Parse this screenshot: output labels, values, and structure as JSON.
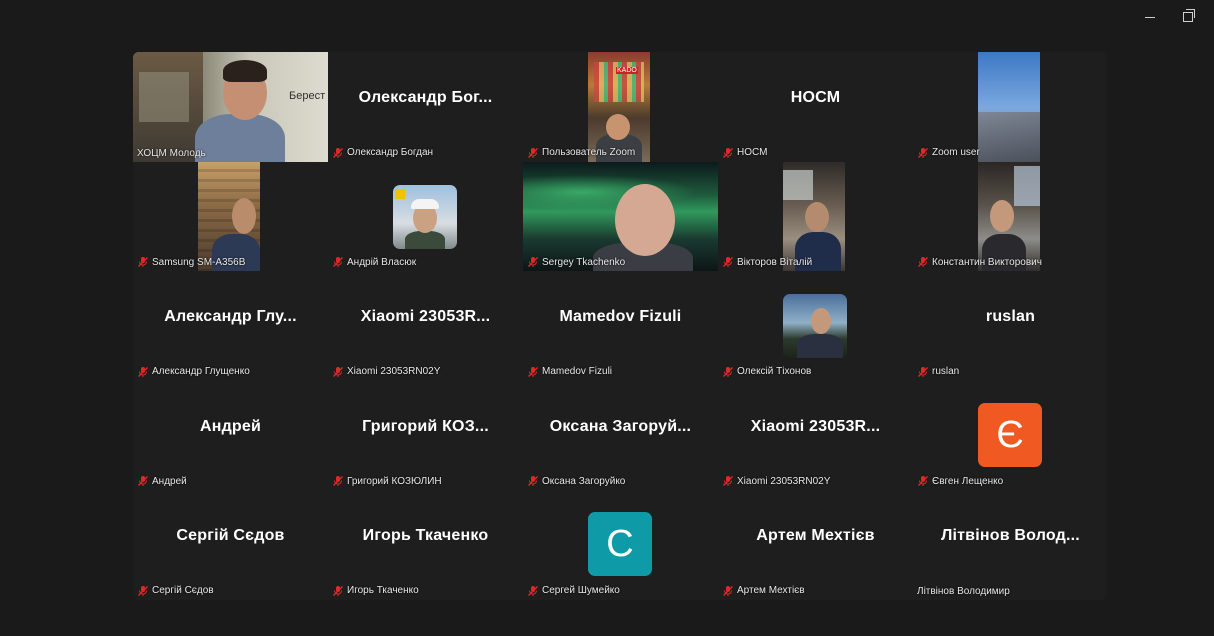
{
  "colors": {
    "background": "#1a1a1a",
    "tile": "#1e1e1e",
    "active_border": "#2fd37a",
    "muted_red": "#e02828"
  },
  "window": {
    "minimize_label": "—",
    "restore_label": "❐"
  },
  "tiles": [
    {
      "big": "",
      "label": "ХОЦМ Молодь",
      "muted": false,
      "overlay": "Берест"
    },
    {
      "big": "Олександр  Бог...",
      "label": "Олександр Богдан",
      "muted": true
    },
    {
      "big": "",
      "label": "Пользователь Zoom",
      "muted": true,
      "overlay": "KADO"
    },
    {
      "big": "НОСМ",
      "label": "НОСМ",
      "muted": true
    },
    {
      "big": "",
      "label": "Zoom user",
      "muted": true
    },
    {
      "big": "",
      "label": "Samsung SM-A356B",
      "muted": true
    },
    {
      "big": "",
      "label": "Андрій Власюк",
      "muted": true
    },
    {
      "big": "",
      "label": "Sergey Tkachenko",
      "muted": true
    },
    {
      "big": "",
      "label": "Вікторов Віталій",
      "muted": true
    },
    {
      "big": "",
      "label": "Константин Викторович",
      "muted": true
    },
    {
      "big": "Александр  Глу...",
      "label": "Александр Глущенко",
      "muted": true
    },
    {
      "big": "Xiaomi  23053R...",
      "label": "Xiaomi 23053RN02Y",
      "muted": true
    },
    {
      "big": "Mamedov Fizuli",
      "label": "Mamedov Fizuli",
      "muted": true
    },
    {
      "big": "",
      "label": "Олексій Тіхонов",
      "muted": true
    },
    {
      "big": "ruslan",
      "label": "ruslan",
      "muted": true
    },
    {
      "big": "Андрей",
      "label": "Андрей",
      "muted": true
    },
    {
      "big": "Григорий  КОЗ...",
      "label": "Григорий КОЗЮЛИН",
      "muted": true
    },
    {
      "big": "Оксана  Загоруй...",
      "label": "Оксана Загоруйко",
      "muted": true
    },
    {
      "big": "Xiaomi  23053R...",
      "label": "Xiaomi 23053RN02Y",
      "muted": true
    },
    {
      "big": "",
      "label": "Євген Лещенко",
      "muted": true,
      "avatar_letter": "Є",
      "avatar_color": "#f05a22"
    },
    {
      "big": "Сергій Сєдов",
      "label": "Сергій Сєдов",
      "muted": true
    },
    {
      "big": "Игорь Ткаченко",
      "label": "Игорь Ткаченко",
      "muted": true
    },
    {
      "big": "",
      "label": "Сергей Шумейко",
      "muted": true,
      "avatar_letter": "С",
      "avatar_color": "#0e9aa7"
    },
    {
      "big": "Артем Мехтієв",
      "label": "Артем Мехтієв",
      "muted": true
    },
    {
      "big": "Літвінов  Волод...",
      "label": "Літвінов Володимир",
      "muted": false
    }
  ]
}
